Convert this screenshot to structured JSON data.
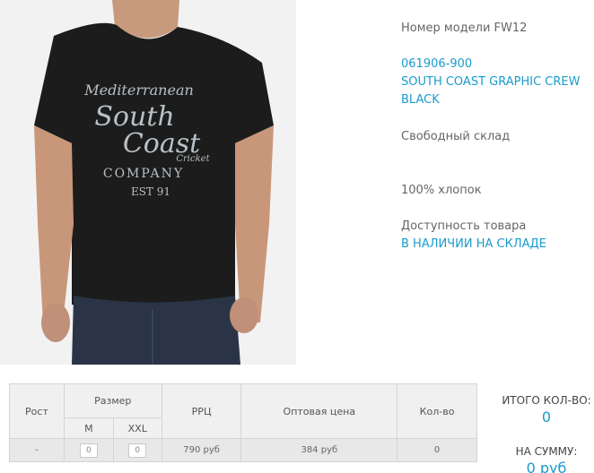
{
  "product": {
    "model_label": "Номер модели FW12",
    "sku": "061906-900",
    "name_line1": "SOUTH COAST GRAPHIC CREW",
    "name_line2": "BLACK",
    "fit": "Свободный склад",
    "material": "100% хлопок",
    "availability_label": "Доступность товара",
    "availability_value": "В НАЛИЧИИ НА СКЛАДЕ",
    "print_text": {
      "line1": "Mediterranean",
      "line2": "South",
      "line3": "Coast",
      "line4": "Cricket",
      "line5": "COMPANY",
      "line6": "EST 91"
    }
  },
  "table": {
    "headers": {
      "height": "Рост",
      "size": "Размер",
      "rrp": "РРЦ",
      "wholesale": "Оптовая цена",
      "qty": "Кол-во"
    },
    "sizes": [
      "M",
      "XXL"
    ],
    "row": {
      "height": "-",
      "qty_m": "0",
      "qty_xxl": "0",
      "rrp": "790 руб",
      "wholesale": "384 руб",
      "qty": "0"
    }
  },
  "totals": {
    "count_label": "ИТОГО КОЛ-ВО:",
    "count_value": "0",
    "sum_label": "НА СУММУ:",
    "sum_value": "0 руб"
  },
  "colors": {
    "accent": "#1a9bcc",
    "shirt": "#1c1c1c",
    "print": "#b8c0c6"
  }
}
